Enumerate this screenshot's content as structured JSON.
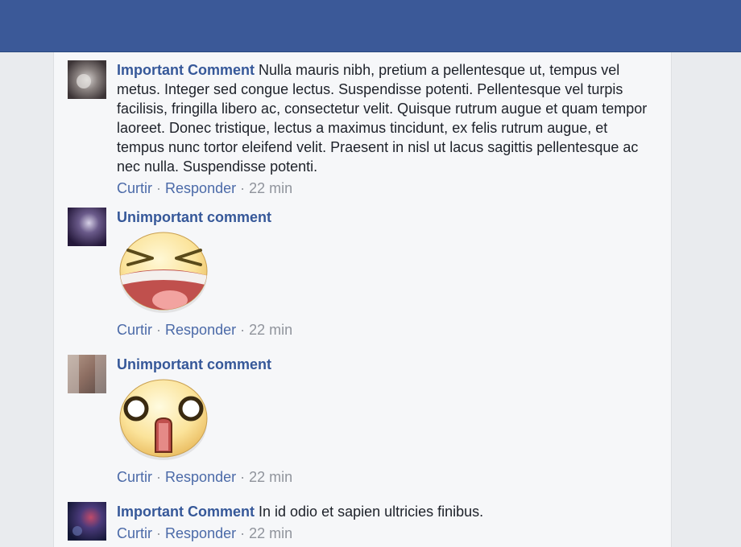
{
  "comments": [
    {
      "author": "Important Comment",
      "text": "Nulla mauris nibh, pretium a pellentesque ut, tempus vel metus. Integer sed congue lectus. Suspendisse potenti. Pellentesque vel turpis facilisis, fringilla libero ac, consectetur velit. Quisque rutrum augue et quam tempor laoreet. Donec tristique, lectus a maximus tincidunt, ex felis rutrum augue, et tempus nunc tortor eleifend velit. Praesent in nisl ut lacus sagittis pellentesque ac nec nulla. Suspendisse potenti.",
      "like": "Curtir",
      "reply": "Responder",
      "time": "22 min",
      "sep": "·"
    },
    {
      "author": "Unimportant comment",
      "sticker": "laughing-face-sticker",
      "like": "Curtir",
      "reply": "Responder",
      "time": "22 min",
      "sep": "·"
    },
    {
      "author": "Unimportant comment",
      "sticker": "shocked-face-sticker",
      "like": "Curtir",
      "reply": "Responder",
      "time": "22 min",
      "sep": "·"
    },
    {
      "author": "Important Comment",
      "text": "In id odio et sapien ultricies finibus.",
      "like": "Curtir",
      "reply": "Responder",
      "time": "22 min",
      "sep": "·"
    }
  ],
  "colors": {
    "header": "#3b5998",
    "author": "#365899",
    "link": "#4b6aa8",
    "muted": "#90949c"
  }
}
